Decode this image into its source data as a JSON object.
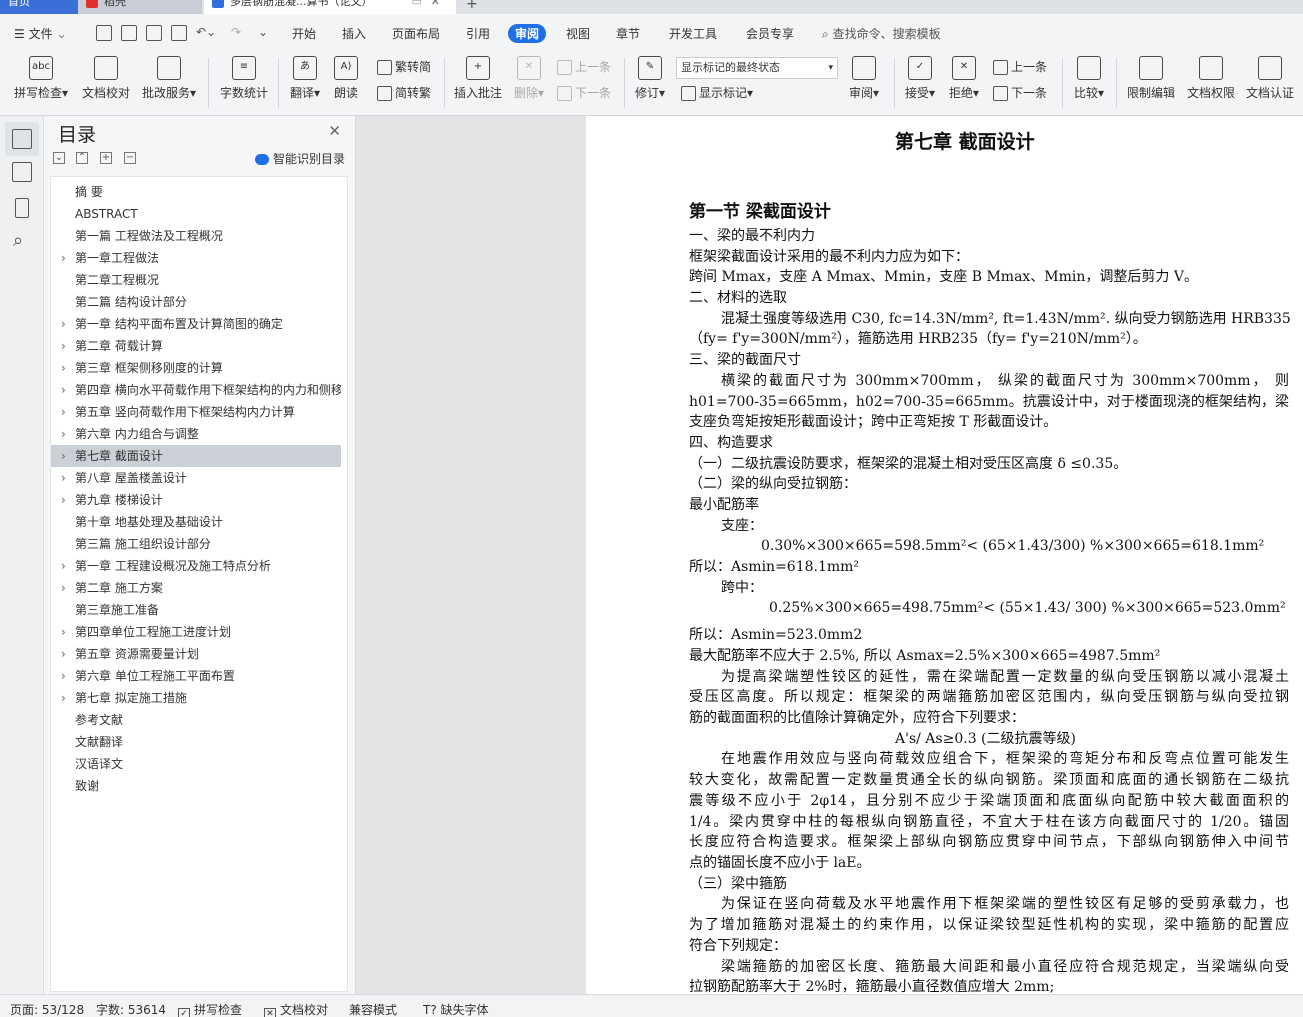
{
  "window": {
    "tabs": [
      {
        "label": "首页"
      },
      {
        "label": "稻壳"
      },
      {
        "label": "多层钢筋混凝...算书（论文）"
      }
    ],
    "new_tab": "+"
  },
  "menu": {
    "file": "文件",
    "items": [
      "开始",
      "插入",
      "页面布局",
      "引用",
      "审阅",
      "视图",
      "章节",
      "开发工具",
      "会员专享"
    ],
    "active": "审阅",
    "search_placeholder": "查找命令、搜索模板"
  },
  "ribbon": {
    "spell_check": "拼写检查",
    "doc_proof": "文档校对",
    "grading": "批改服务",
    "word_count": "字数统计",
    "translate": "翻译",
    "read_aloud": "朗读",
    "to_traditional": "繁转简",
    "to_simplified": "简转繁",
    "insert_comment": "插入批注",
    "delete": "删除",
    "prev_comment": "上一条",
    "next_comment": "下一条",
    "track": "修订",
    "markup_mode": "显示标记的最终状态",
    "show_markup": "显示标记",
    "review": "审阅",
    "accept": "接受",
    "reject": "拒绝",
    "prev_change": "上一条",
    "next_change": "下一条",
    "compare": "比较",
    "restrict_edit": "限制编辑",
    "doc_permission": "文档权限",
    "doc_cert": "文档认证"
  },
  "toc": {
    "title": "目录",
    "smart_label": "智能识别目录",
    "items": [
      {
        "text": "摘  要",
        "chev": false
      },
      {
        "text": "ABSTRACT",
        "chev": false
      },
      {
        "text": "第一篇    工程做法及工程概况",
        "chev": false
      },
      {
        "text": "第一章工程做法",
        "chev": true
      },
      {
        "text": "第二章工程概况",
        "chev": false
      },
      {
        "text": "第二篇    结构设计部分",
        "chev": false
      },
      {
        "text": "第一章    结构平面布置及计算简图的确定",
        "chev": true
      },
      {
        "text": "第二章    荷载计算",
        "chev": true
      },
      {
        "text": "第三章    框架侧移刚度的计算",
        "chev": true
      },
      {
        "text": "第四章    横向水平荷载作用下框架结构的内力和侧移计算",
        "chev": true
      },
      {
        "text": "第五章    竖向荷载作用下框架结构内力计算",
        "chev": true
      },
      {
        "text": "第六章    内力组合与调整",
        "chev": true
      },
      {
        "text": "第七章    截面设计",
        "chev": true,
        "selected": true
      },
      {
        "text": "第八章    屋盖楼盖设计",
        "chev": true
      },
      {
        "text": "第九章  楼梯设计",
        "chev": true
      },
      {
        "text": "第十章  地基处理及基础设计",
        "chev": false
      },
      {
        "text": "第三篇    施工组织设计部分",
        "chev": false
      },
      {
        "text": "第一章    工程建设概况及施工特点分析",
        "chev": true
      },
      {
        "text": "第二章    施工方案",
        "chev": true
      },
      {
        "text": "第三章施工准备",
        "chev": false
      },
      {
        "text": "第四章单位工程施工进度计划",
        "chev": true
      },
      {
        "text": "第五章    资源需要量计划",
        "chev": true
      },
      {
        "text": "第六章    单位工程施工平面布置",
        "chev": true
      },
      {
        "text": "第七章    拟定施工措施",
        "chev": true
      },
      {
        "text": "参考文献",
        "chev": false
      },
      {
        "text": "文献翻译",
        "chev": false
      },
      {
        "text": "                                  汉语译文",
        "chev": false
      },
      {
        "text": "致谢",
        "chev": false
      }
    ]
  },
  "document": {
    "chapter_title": "第七章    截面设计",
    "lines": [
      {
        "t": "第一节    梁截面设计",
        "cls": "sec"
      },
      {
        "t": "一、梁的最不利内力"
      },
      {
        "t": "框架梁截面设计采用的最不利内力应为如下："
      },
      {
        "t": "跨间 Mmax，支座 A Mmax、Mmin，支座 B Mmax、Mmin，调整后剪力 V。"
      },
      {
        "t": "二、材料的选取"
      },
      {
        "t": "混凝土强度等级选用 C30, fc=14.3N/mm², ft=1.43N/mm². 纵向受力钢筋选用 HRB335",
        "indent": 32,
        "j": true
      },
      {
        "t": "（fy= f'y=300N/mm²），箍筋选用 HRB235（fy= f'y=210N/mm²）。"
      },
      {
        "t": "三、梁的截面尺寸"
      },
      {
        "t": "横梁的截面尺寸为 300mm×700mm， 纵梁的截面尺寸为 300mm×700mm， 则",
        "indent": 32,
        "j": true
      },
      {
        "t": "h01=700-35=665mm，h02=700-35=665mm。抗震设计中，对于楼面现浇的框架结构，梁",
        "j": true
      },
      {
        "t": "支座负弯矩按矩形截面设计；跨中正弯矩按 T 形截面设计。"
      },
      {
        "t": "四、构造要求"
      },
      {
        "t": "（一）二级抗震设防要求，框架梁的混凝土相对受压区高度 δ ≤0.35。"
      },
      {
        "t": "（二）梁的纵向受拉钢筋："
      },
      {
        "t": "最小配筋率"
      },
      {
        "t": "支座：",
        "indent": 32
      },
      {
        "t": "0.30%×300×665=598.5mm²< (65×1.43/300) %×300×665=618.1mm²",
        "indent": 72
      },
      {
        "t": "所以：Asmin=618.1mm²"
      },
      {
        "t": "跨中：",
        "indent": 32
      },
      {
        "t": "0.25%×300×665=498.75mm²< (55×1.43/ 300) %×300×665=523.0mm²",
        "indent": 80
      },
      {
        "t": "所以：Asmin=523.0mm2"
      },
      {
        "t": "最大配筋率不应大于 2.5%, 所以 Asmax=2.5%×300×665=4987.5mm²"
      },
      {
        "t": "为提高梁端塑性铰区的延性，需在梁端配置一定数量的纵向受压钢筋以减小混凝土",
        "indent": 32,
        "j": true
      },
      {
        "t": "受压区高度。所以规定：框架梁的两端箍筋加密区范围内，纵向受压钢筋与纵向受拉钢",
        "j": true
      },
      {
        "t": "筋的截面面积的比值除计算确定外，应符合下列要求："
      },
      {
        "t": "A's/ As≥0.3 (二级抗震等级)",
        "indent": 206
      },
      {
        "t": "在地震作用效应与竖向荷载效应组合下，框架梁的弯矩分布和反弯点位置可能发生",
        "indent": 32,
        "j": true
      },
      {
        "t": "较大变化，故需配置一定数量贯通全长的纵向钢筋。梁顶面和底面的通长钢筋在二级抗",
        "j": true
      },
      {
        "t": "震等级不应小于 2φ14，且分别不应少于梁端顶面和底面纵向配筋中较大截面面积的",
        "j": true
      },
      {
        "t": "1/4。梁内贯穿中柱的每根纵向钢筋直径，不宜大于柱在该方向截面尺寸的 1/20。锚固",
        "j": true
      },
      {
        "t": "长度应符合构造要求。框架梁上部纵向钢筋应贯穿中间节点，下部纵向钢筋伸入中间节",
        "j": true
      },
      {
        "t": "点的锚固长度不应小于 laE。"
      },
      {
        "t": "（三）梁中箍筋"
      },
      {
        "t": "为保证在竖向荷载及水平地震作用下框架梁端的塑性铰区有足够的受剪承载力，也",
        "indent": 32,
        "j": true
      },
      {
        "t": "为了增加箍筋对混凝土的约束作用，以保证梁铰型延性机构的实现，梁中箍筋的配置应",
        "j": true
      },
      {
        "t": "符合下列规定："
      },
      {
        "t": "梁端箍筋的加密区长度、箍筋最大间距和最小直径应符合规范规定，当梁端纵向受",
        "indent": 32,
        "j": true
      },
      {
        "t": "拉钢筋配筋率大于 2%时，箍筋最小直径数值应增大 2mm;"
      }
    ]
  },
  "status": {
    "page": "页面: 53/128",
    "words": "字数: 53614",
    "spell": "拼写检查",
    "proof": "文档校对",
    "compat": "兼容模式",
    "missing_font": "缺失字体"
  }
}
